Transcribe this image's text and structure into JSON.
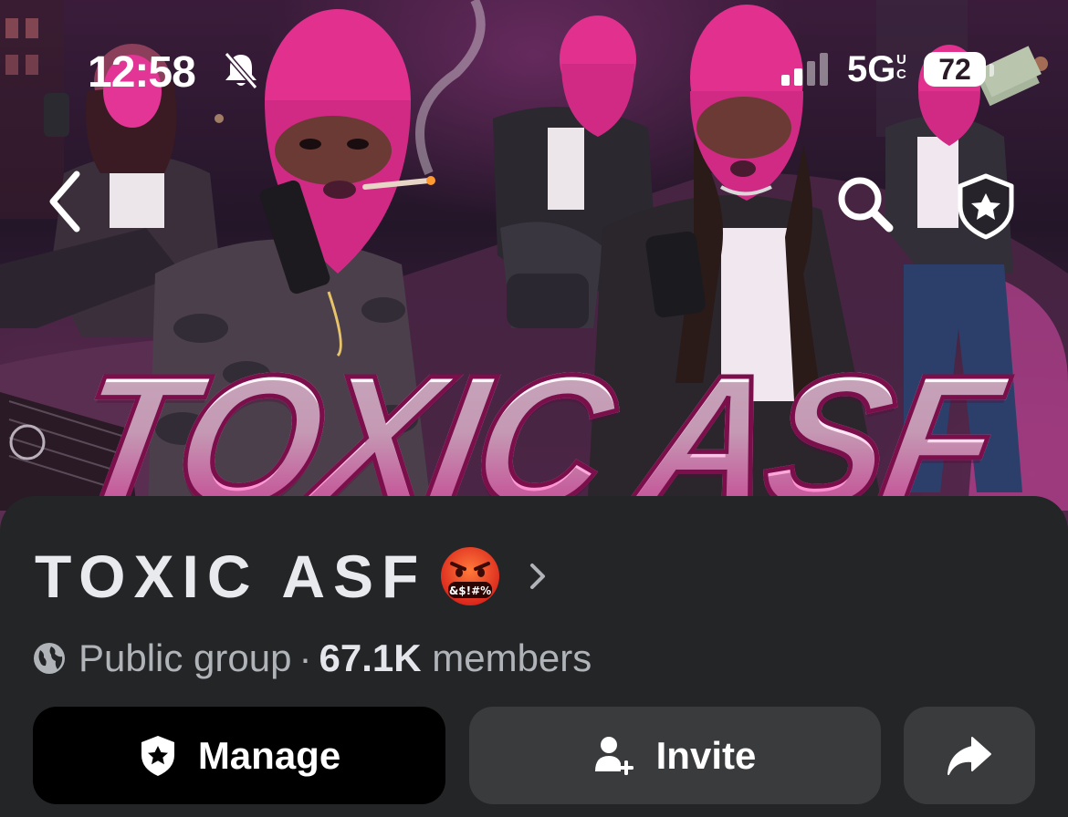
{
  "status_bar": {
    "time": "12:58",
    "network": "5G",
    "network_suffix_top": "U",
    "network_suffix_bottom": "C",
    "battery": "72"
  },
  "cover": {
    "title_text": "TOXIC ASF"
  },
  "group": {
    "name": "TOXIC ASF",
    "privacy": "Public group",
    "separator": "·",
    "member_count": "67.1K",
    "members_label": "members"
  },
  "actions": {
    "manage_label": "Manage",
    "invite_label": "Invite"
  },
  "icons": {
    "back": "chevron-left-icon",
    "search": "search-icon",
    "admin": "shield-star-icon",
    "bell": "bell-slash-icon",
    "emoji": "angry-emoji-icon",
    "globe": "globe-icon",
    "invite": "add-person-icon",
    "share": "share-arrow-icon"
  },
  "colors": {
    "panel_bg": "#242526",
    "manage_bg": "#000000",
    "secondary_btn_bg": "#3a3b3c",
    "muted_text": "#b0b3b8",
    "cover_accent": "#ff4fb8"
  }
}
